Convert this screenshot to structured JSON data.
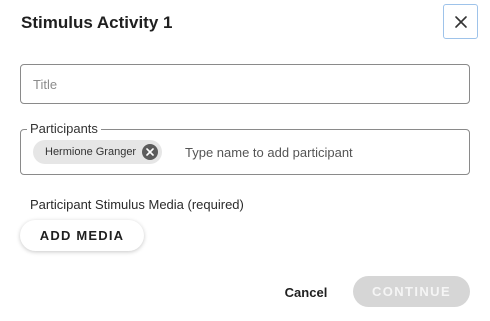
{
  "dialog": {
    "title": "Stimulus Activity 1",
    "close_icon": "close-icon"
  },
  "title_field": {
    "placeholder": "Title",
    "value": ""
  },
  "participants": {
    "legend": "Participants",
    "chips": [
      {
        "name": "Hermione Granger",
        "remove_icon": "close-circle-icon"
      }
    ],
    "input_placeholder": "Type name to add participant",
    "input_value": ""
  },
  "media": {
    "label": "Participant Stimulus Media (required)",
    "add_button": "ADD MEDIA"
  },
  "footer": {
    "cancel": "Cancel",
    "continue": "CONTINUE",
    "continue_disabled": true
  },
  "colors": {
    "focus_border": "#9ec3ea",
    "field_border": "#8a8a8a",
    "chip_bg": "#e6e6e6",
    "disabled_bg": "#d6d6d6"
  }
}
